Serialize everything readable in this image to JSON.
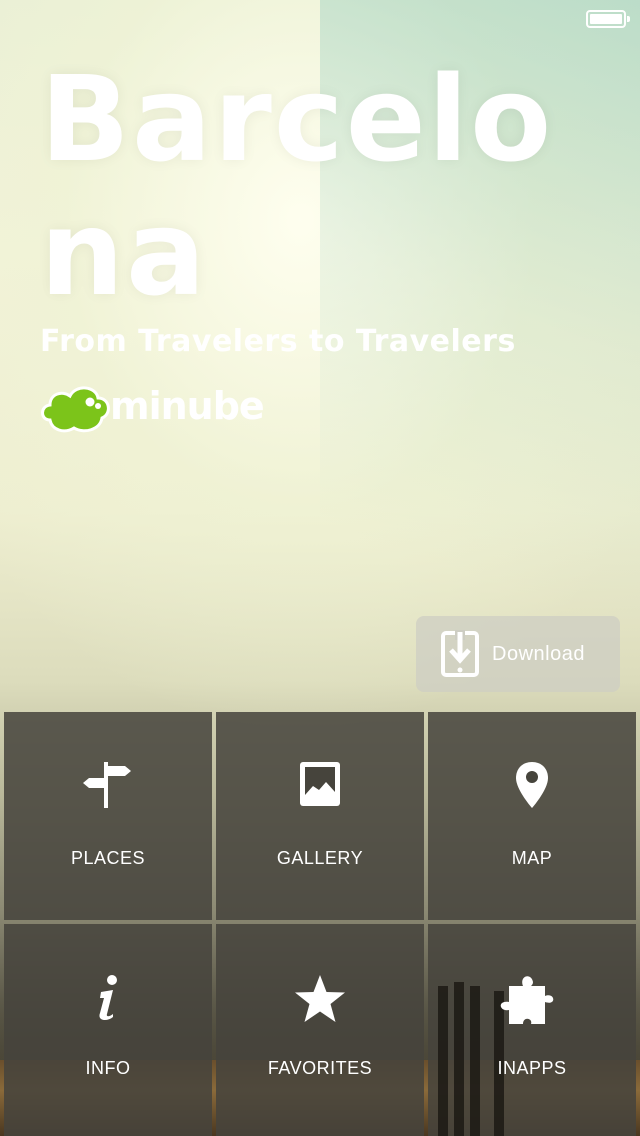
{
  "colors": {
    "tile_background": "#46443c",
    "brand_green": "#7cc41a",
    "text": "#ffffff",
    "download_background": "#cdcdc3"
  },
  "status_bar": {
    "battery_level": 1.0
  },
  "hero": {
    "title": "Barcelona",
    "subtitle": "From Travelers to Travelers",
    "brand_name": "minube",
    "brand_icon": "cloud-logo-icon"
  },
  "download": {
    "label": "Download",
    "icon": "tablet-download-icon"
  },
  "menu": [
    {
      "label": "PLACES",
      "icon": "signpost-icon"
    },
    {
      "label": "GALLERY",
      "icon": "image-icon"
    },
    {
      "label": "MAP",
      "icon": "map-pin-icon"
    },
    {
      "label": "INFO",
      "icon": "info-icon"
    },
    {
      "label": "FAVORITES",
      "icon": "star-icon"
    },
    {
      "label": "INAPPS",
      "icon": "puzzle-icon"
    }
  ]
}
